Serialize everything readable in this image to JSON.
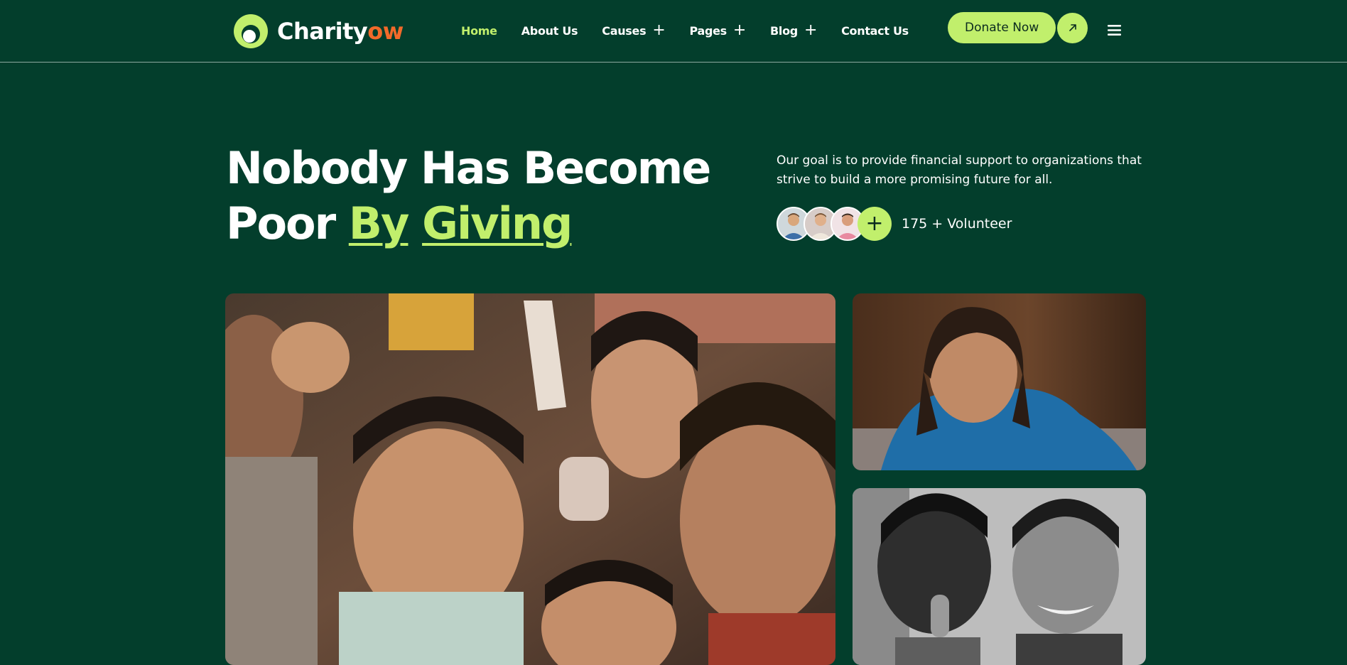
{
  "brand": {
    "name_main": "Charity",
    "name_accent": "ow",
    "accent_color": "#c1ef6c",
    "logo_accent_color": "#f26a2a",
    "background_color": "#033e2c"
  },
  "nav": {
    "items": [
      {
        "label": "Home",
        "active": true,
        "has_submenu": false
      },
      {
        "label": "About Us",
        "active": false,
        "has_submenu": false
      },
      {
        "label": "Causes",
        "active": false,
        "has_submenu": true
      },
      {
        "label": "Pages",
        "active": false,
        "has_submenu": true
      },
      {
        "label": "Blog",
        "active": false,
        "has_submenu": true
      },
      {
        "label": "Contact Us",
        "active": false,
        "has_submenu": false
      }
    ],
    "submenu_icon": "plus-icon",
    "menu_icon": "hamburger-icon"
  },
  "cta": {
    "donate_label": "Donate Now",
    "donate_icon": "arrow-up-right-icon"
  },
  "hero": {
    "title_line1": "Nobody Has Become",
    "title_line2_plain": "Poor ",
    "title_line2_hl1": "By",
    "title_line2_hl2": "Giving",
    "description": "Our goal is to provide financial support to organizations that strive to build a more promising future for all.",
    "volunteer_label": "175 + Volunteer",
    "volunteer_add_icon": "plus-icon"
  },
  "images": {
    "main": "group-of-smiling-children-photo",
    "right_top": "girl-in-blue-sweater-photo",
    "right_bottom": "two-boys-black-and-white-photo"
  }
}
